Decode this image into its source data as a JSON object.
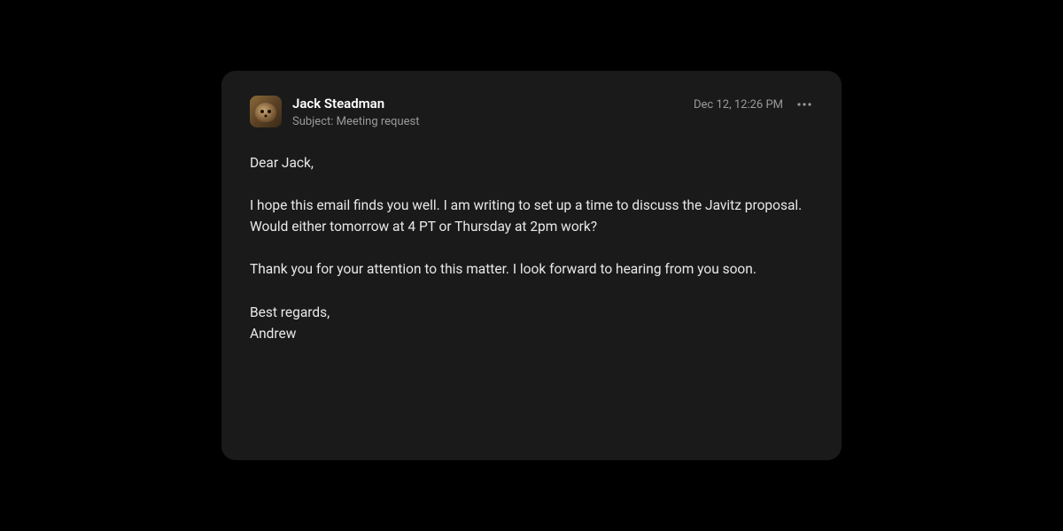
{
  "email": {
    "sender_name": "Jack Steadman",
    "subject_prefix": "Subject: ",
    "subject": "Meeting request",
    "timestamp": "Dec 12, 12:26 PM",
    "body": "Dear Jack,\n\nI hope this email finds you well. I am writing to set up a time to discuss the Javitz proposal. Would either tomorrow at 4 PT or Thursday at 2pm work?\n\nThank you for your attention to this matter. I look forward to hearing from you soon.\n\nBest regards,\nAndrew"
  }
}
